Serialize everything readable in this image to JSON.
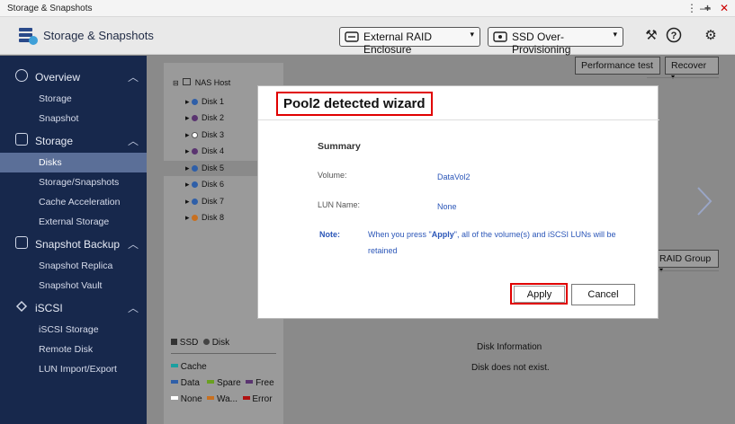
{
  "window": {
    "title": "Storage & Snapshots",
    "controls": [
      "⋮",
      "—",
      "+",
      "✕"
    ]
  },
  "header": {
    "app_title": "Storage & Snapshots",
    "raid_select": "External RAID Enclosure",
    "ssd_select": "SSD Over-Provisioning",
    "icons": [
      "tools-icon",
      "help-icon",
      "settings-icon"
    ]
  },
  "sidebar": {
    "sections": [
      {
        "label": "Overview",
        "icon": "overview-icon",
        "items": [
          "Storage",
          "Snapshot"
        ]
      },
      {
        "label": "Storage",
        "icon": "storage-icon",
        "items": [
          "Disks",
          "Storage/Snapshots",
          "Cache Acceleration",
          "External Storage"
        ]
      },
      {
        "label": "Snapshot Backup",
        "icon": "snapshot-backup-icon",
        "items": [
          "Snapshot Replica",
          "Snapshot Vault"
        ]
      },
      {
        "label": "iSCSI",
        "icon": "iscsi-icon",
        "items": [
          "iSCSI Storage",
          "Remote Disk",
          "LUN Import/Export"
        ]
      }
    ],
    "active_item": "Disks"
  },
  "main": {
    "performance_button": "Performance test",
    "recover_button": "Recover",
    "raid_group_button": "RAID Group",
    "tree_root": "NAS Host",
    "disks": [
      {
        "label": "Disk 1",
        "color": "#2f5fa8"
      },
      {
        "label": "Disk 2",
        "color": "#5a3470"
      },
      {
        "label": "Disk 3",
        "color": "#ffffff"
      },
      {
        "label": "Disk 4",
        "color": "#5a3470"
      },
      {
        "label": "Disk 5",
        "color": "#2f5fa8"
      },
      {
        "label": "Disk 6",
        "color": "#2f5fa8"
      },
      {
        "label": "Disk 7",
        "color": "#2f5fa8"
      },
      {
        "label": "Disk 8",
        "color": "#c87020"
      }
    ],
    "legend_types": [
      "SSD",
      "Disk"
    ],
    "legend": [
      {
        "label": "Cache",
        "color": "#1aa0a0"
      },
      {
        "label": "Data",
        "color": "#2f5fa8"
      },
      {
        "label": "Spare",
        "color": "#6aa020"
      },
      {
        "label": "Free",
        "color": "#5a3470"
      },
      {
        "label": "None",
        "color": "#ffffff"
      },
      {
        "label": "Wa...",
        "color": "#c87020"
      },
      {
        "label": "Error",
        "color": "#b01010"
      }
    ],
    "disk_info_title": "Disk Information",
    "disk_info_text": "Disk does not exist."
  },
  "dialog": {
    "title": "Pool2 detected wizard",
    "summary": "Summary",
    "volume_label": "Volume:",
    "volume_value": "DataVol2",
    "lun_label": "LUN Name:",
    "lun_value": "None",
    "note_label": "Note:",
    "note_pre": "When you press \"",
    "note_bold": "Apply",
    "note_post": "\", all of the volume(s) and iSCSI LUNs will be",
    "note_line2": "retained",
    "apply_button": "Apply",
    "cancel_button": "Cancel",
    "highlight_color": "#e00000"
  }
}
